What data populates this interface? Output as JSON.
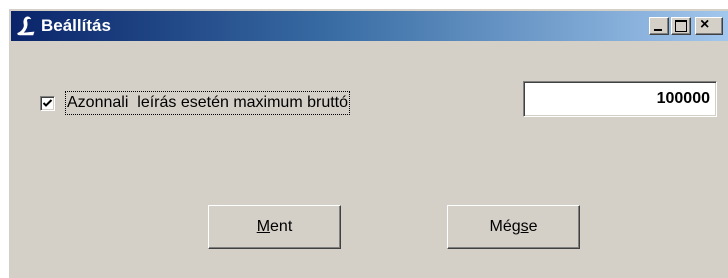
{
  "window": {
    "title": "Beállítás",
    "icon": "stylized-L-icon",
    "controls": {
      "minimize": "minimize-icon",
      "maximize": "maximize-icon",
      "close": "×"
    }
  },
  "settings": {
    "checkbox_checked": true,
    "checkbox_label": "Azonnali  leírás esetén maximum bruttó",
    "value": "100000"
  },
  "buttons": {
    "save": {
      "label": "Ment",
      "mnemonic": "M",
      "rest": "ent"
    },
    "cancel": {
      "label": "Mégse",
      "prefix": "Még",
      "mnemonic": "s",
      "rest": "e"
    }
  },
  "colors": {
    "titlebar_start": "#0a246a",
    "titlebar_end": "#a6caf0",
    "face": "#d4d0c8"
  }
}
